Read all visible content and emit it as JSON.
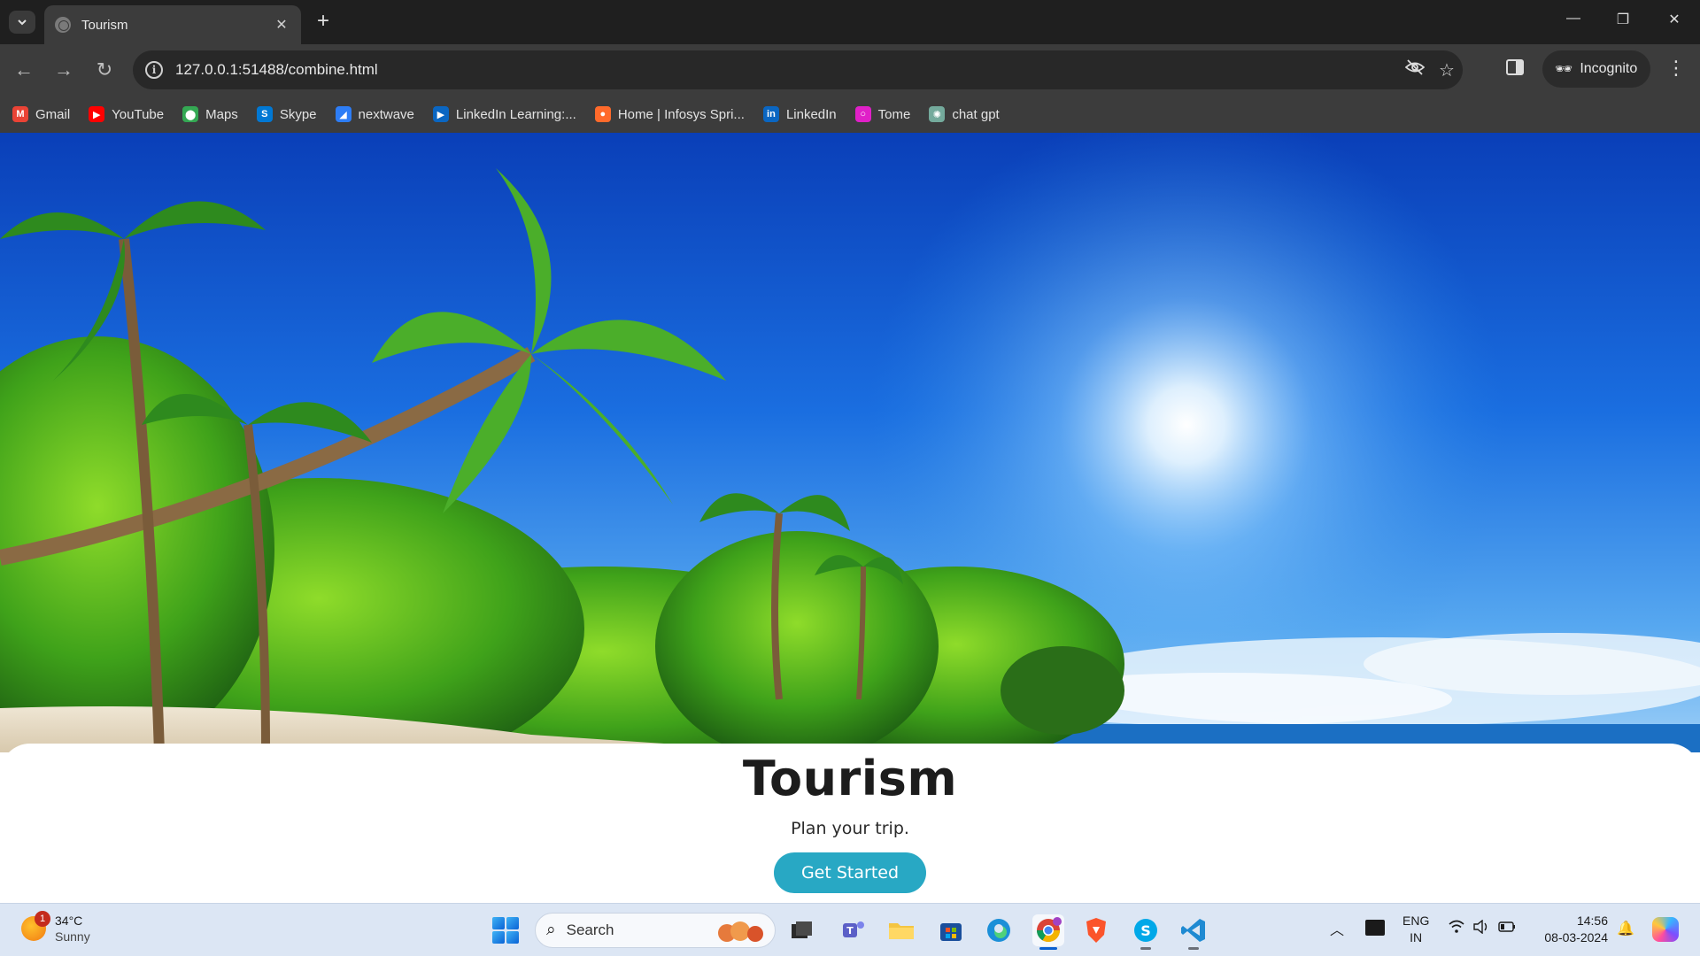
{
  "browser": {
    "tab": {
      "title": "Tourism"
    },
    "url": "127.0.0.1:51488/combine.html",
    "incognito_label": "Incognito",
    "bookmarks": [
      {
        "label": "Gmail",
        "icon": "gmail-icon",
        "color": "#ea4335"
      },
      {
        "label": "YouTube",
        "icon": "youtube-icon",
        "color": "#ff0000"
      },
      {
        "label": "Maps",
        "icon": "maps-icon",
        "color": "#34a853"
      },
      {
        "label": "Skype",
        "icon": "skype-icon",
        "color": "#0078d4"
      },
      {
        "label": "nextwave",
        "icon": "nextwave-icon",
        "color": "#2d7df6"
      },
      {
        "label": "LinkedIn Learning:...",
        "icon": "linkedin-learning-icon",
        "color": "#0a66c2"
      },
      {
        "label": "Home | Infosys Spri...",
        "icon": "infosys-icon",
        "color": "#ff6a2b"
      },
      {
        "label": "LinkedIn",
        "icon": "linkedin-icon",
        "color": "#0a66c2"
      },
      {
        "label": "Tome",
        "icon": "tome-icon",
        "color": "#e020c8"
      },
      {
        "label": "chat gpt",
        "icon": "chatgpt-icon",
        "color": "#74aa9c"
      }
    ]
  },
  "page": {
    "title": "Tourism",
    "subtitle": "Plan your trip.",
    "cta_label": "Get Started",
    "accent_color": "#28a8c4"
  },
  "taskbar": {
    "weather": {
      "badge": "1",
      "temp": "34°C",
      "condition": "Sunny"
    },
    "search_label": "Search",
    "lang_top": "ENG",
    "lang_bottom": "IN",
    "time": "14:56",
    "date": "08-03-2024"
  }
}
